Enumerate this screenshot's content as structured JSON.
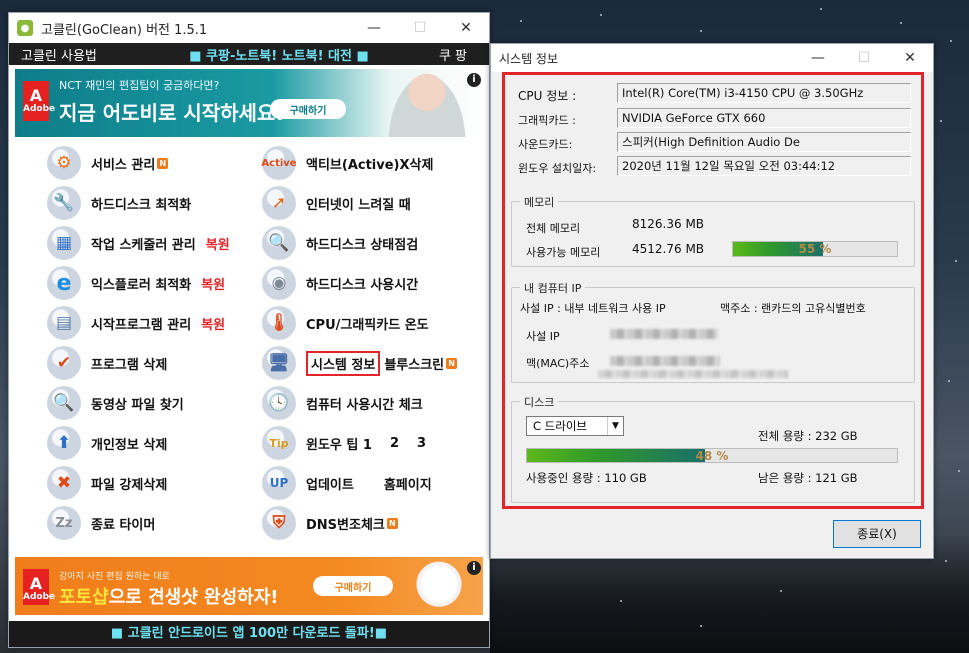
{
  "main_window": {
    "title": "고클린(GoClean) 버전 1.5.1",
    "menu": {
      "left": "고클린 사용법",
      "center": "■ 쿠팡-노트북! 노트북! 대전 ■",
      "right": "쿠 팡"
    },
    "ad_top": {
      "logo": "Adobe",
      "subtitle": "NCT 재민의 편집팁이 궁금하다면?",
      "headline": "지금 어도비로 시작하세요!",
      "button": "구매하기"
    },
    "items_left": [
      {
        "label": "서비스 관리",
        "icon": "gear-icon",
        "badge": "N",
        "extra": ""
      },
      {
        "label": "하드디스크 최적화",
        "icon": "wrench-icon",
        "badge": "",
        "extra": ""
      },
      {
        "label": "작업 스케줄러 관리",
        "icon": "calendar-icon",
        "badge": "",
        "extra": "복원"
      },
      {
        "label": "익스플로러 최적화",
        "icon": "ie-icon",
        "badge": "",
        "extra": "복원"
      },
      {
        "label": "시작프로그램 관리",
        "icon": "document-icon",
        "badge": "",
        "extra": "복원"
      },
      {
        "label": "프로그램 삭제",
        "icon": "checklist-icon",
        "badge": "",
        "extra": ""
      },
      {
        "label": "동영상 파일 찾기",
        "icon": "magnifier-icon",
        "badge": "",
        "extra": ""
      },
      {
        "label": "개인정보 삭제",
        "icon": "personal-info-icon",
        "badge": "",
        "extra": ""
      },
      {
        "label": "파일 강제삭제",
        "icon": "delete-icon",
        "badge": "",
        "extra": ""
      },
      {
        "label": "종료 타이머",
        "icon": "sleep-icon",
        "badge": "",
        "extra": ""
      }
    ],
    "items_right": [
      {
        "label": "액티브(Active)X삭제",
        "icon": "activex-icon",
        "badge": "",
        "extra": ""
      },
      {
        "label": "인터넷이 느려질 때",
        "icon": "arrow-up-icon",
        "badge": "",
        "extra": ""
      },
      {
        "label": "하드디스크 상태점검",
        "icon": "disk-check-icon",
        "badge": "",
        "extra": ""
      },
      {
        "label": "하드디스크 사용시간",
        "icon": "disk-time-icon",
        "badge": "",
        "extra": ""
      },
      {
        "label": "CPU/그래픽카드 온도",
        "icon": "thermometer-icon",
        "badge": "",
        "extra": ""
      },
      {
        "label": "시스템 정보",
        "icon": "computer-icon",
        "badge": "",
        "extra": "블루스크린",
        "extra_badge": "N"
      },
      {
        "label": "컴퓨터 사용시간 체크",
        "icon": "clock-icon",
        "badge": "",
        "extra": ""
      },
      {
        "label": "윈도우 팁 1",
        "icon": "windows-tip-icon",
        "badge": "",
        "extra": "2",
        "extra2": "3"
      },
      {
        "label": "업데이트",
        "icon": "update-icon",
        "badge": "",
        "extra": "홈페이지"
      },
      {
        "label": "DNS변조체크",
        "icon": "shield-icon",
        "badge": "N",
        "extra": ""
      }
    ],
    "ad_bottom": {
      "logo": "Adobe",
      "subtitle": "강아지 사진 편집 원하는 대로",
      "headline_highlight": "포토샵",
      "headline_rest": "으로 견생샷 완성하자!",
      "button": "구매하기"
    },
    "footer": "■ 고클린 안드로이드 앱 100만 다운로드 돌파!■"
  },
  "system_window": {
    "title": "시스템 정보",
    "cpu_label": "CPU 정보 :",
    "cpu_value": "Intel(R) Core(TM) i3-4150 CPU @ 3.50GHz",
    "gpu_label": "그래픽카드 :",
    "gpu_value": "NVIDIA GeForce GTX 660",
    "sound_label": "사운드카드:",
    "sound_value": "스피커(High Definition Audio De",
    "install_label": "윈도우 설치일자:",
    "install_value": "2020년 11월 12일 목요일 오전 03:44:12",
    "memory": {
      "group": "메모리",
      "total_label": "전체 메모리",
      "total_value": "8126.36 MB",
      "avail_label": "사용가능 메모리",
      "avail_value": "4512.76 MB",
      "usage_fraction": 0.55,
      "usage_text": "55 %"
    },
    "network": {
      "group": "내 컴퓨터 IP",
      "ip_desc": "사설 IP : 내부 네트워크 사용 IP",
      "mac_desc": "맥주소 : 랜카드의 고유식별번호",
      "ip_label": "사설 IP",
      "mac_label": "맥(MAC)주소"
    },
    "disk": {
      "group": "디스크",
      "drive": "C 드라이브",
      "total": "전체 용량 : 232 GB",
      "usage_fraction": 0.48,
      "usage_text": "48 %",
      "used": "사용중인 용량 : 110 GB",
      "free": "남은 용량 : 121 GB"
    },
    "close_button": "종료(X)"
  }
}
